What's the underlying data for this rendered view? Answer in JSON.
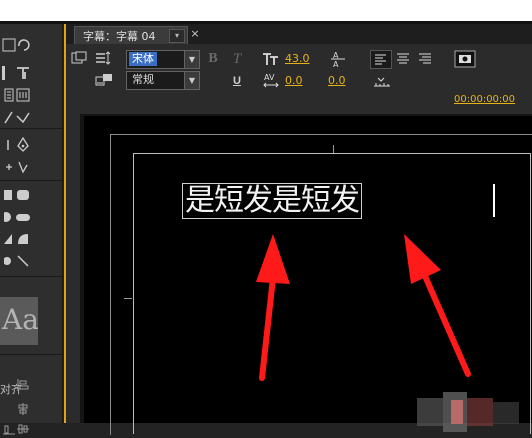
{
  "tab": {
    "title": "字幕：字幕 04",
    "menu_arrow": "▾",
    "close": "×"
  },
  "toolbar": {
    "font_family": "宋体",
    "font_style": "常规",
    "bold_label": "B",
    "italic_label": "T",
    "underline_label": "U",
    "font_size": "43.0",
    "kerning": "0.0",
    "leading": "0.0",
    "tracking": "0.0",
    "timecode": "00:00:00:00"
  },
  "canvas": {
    "title_text": "是短发是短发"
  },
  "left_panel": {
    "style_preview": "Aa",
    "align_section_label": "对齐"
  },
  "colors": {
    "accent": "#e6b21a",
    "selection": "#3a6ec2",
    "annotation_arrow": "#ff1a1a"
  }
}
